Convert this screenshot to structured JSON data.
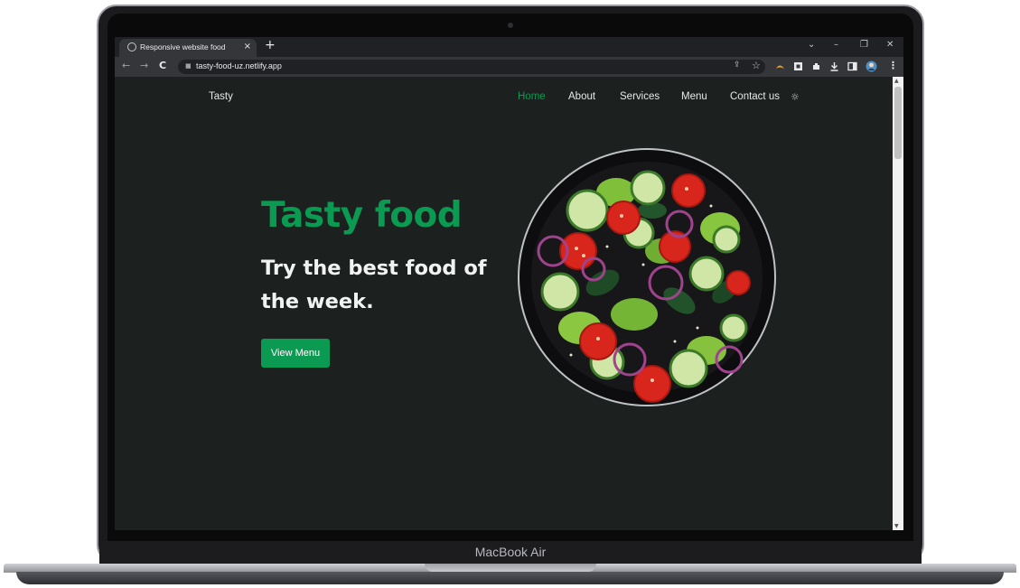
{
  "browser": {
    "tab_title": "Responsive website food",
    "tab_close": "×",
    "new_tab": "+",
    "url": "tasty-food-uz.netlify.app",
    "window_controls": [
      "⌄",
      "–",
      "❐",
      "✕"
    ]
  },
  "site": {
    "logo": "Tasty",
    "nav": [
      {
        "label": "Home",
        "active": true
      },
      {
        "label": "About",
        "active": false
      },
      {
        "label": "Services",
        "active": false
      },
      {
        "label": "Menu",
        "active": false
      },
      {
        "label": "Contact us",
        "active": false
      }
    ],
    "theme_toggle_icon": "sun-icon",
    "hero_title": "Tasty food",
    "hero_subtitle": "Try the best food of the week.",
    "cta_label": "View Menu",
    "accent_color": "#0b9a51",
    "background_color": "#1c201f"
  },
  "device": {
    "label": "MacBook Air"
  }
}
